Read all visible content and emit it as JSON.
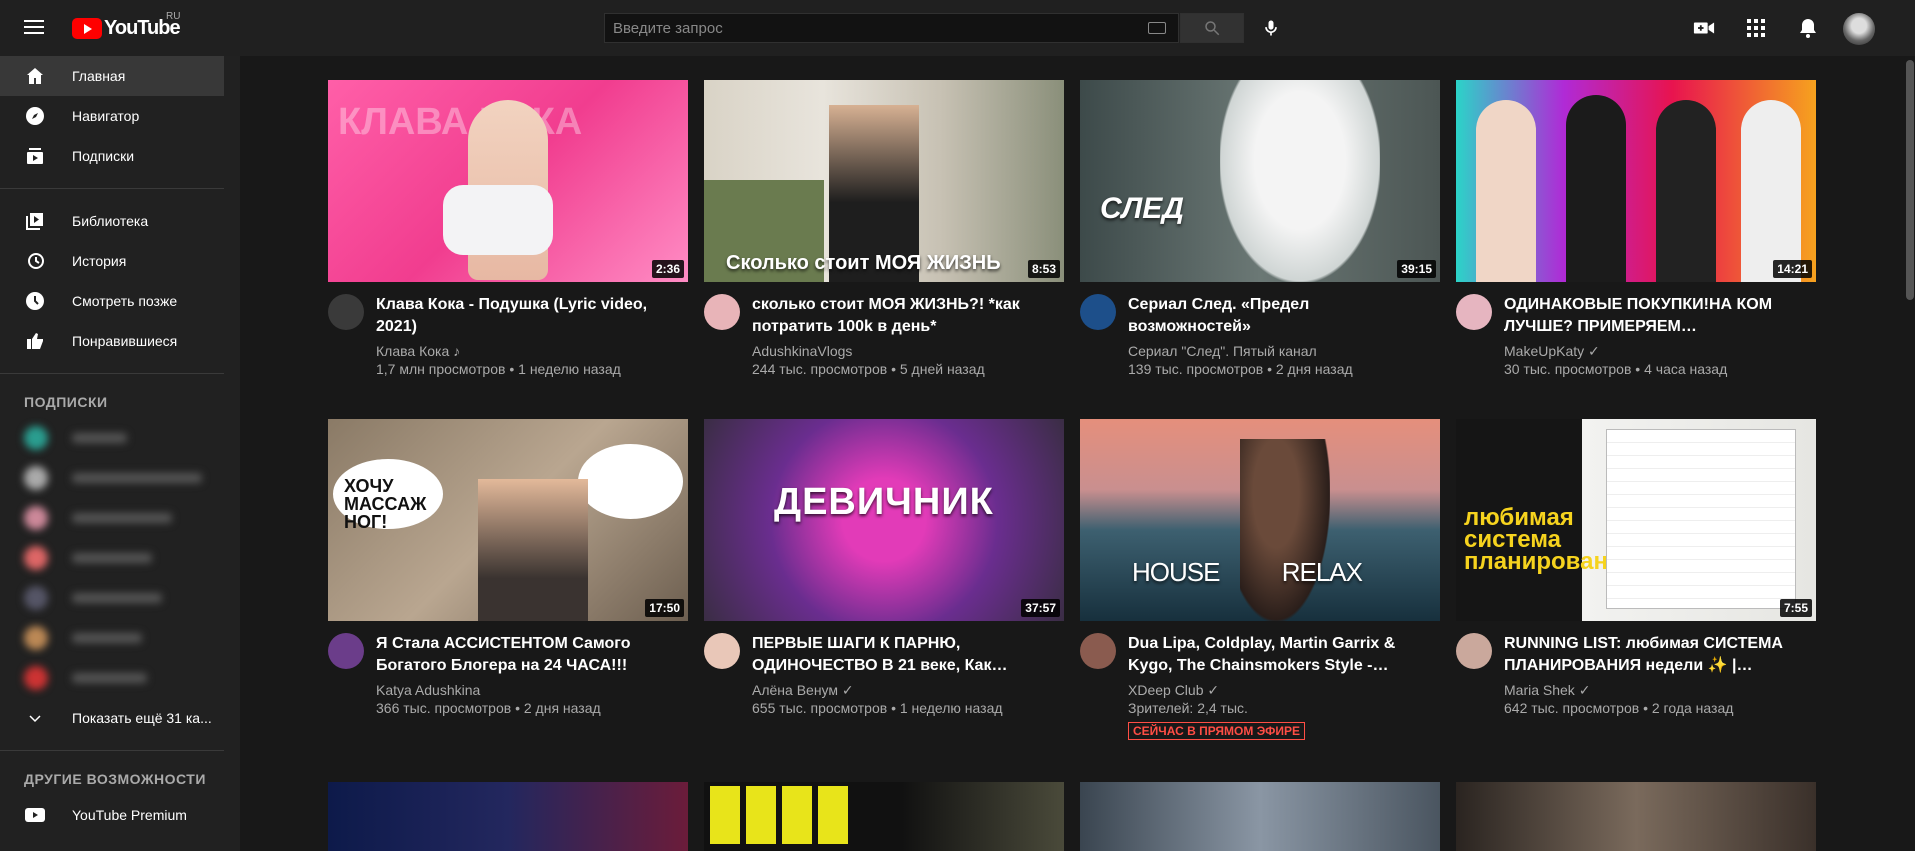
{
  "header": {
    "logo_text": "YouTube",
    "region": "RU",
    "search_placeholder": "Введите запрос"
  },
  "sidebar": {
    "main": [
      {
        "label": "Главная",
        "icon": "home-icon"
      },
      {
        "label": "Навигатор",
        "icon": "compass-icon"
      },
      {
        "label": "Подписки",
        "icon": "subscriptions-icon"
      }
    ],
    "library": [
      {
        "label": "Библиотека",
        "icon": "library-icon"
      },
      {
        "label": "История",
        "icon": "history-icon"
      },
      {
        "label": "Смотреть позже",
        "icon": "clock-icon"
      },
      {
        "label": "Понравившиеся",
        "icon": "thumbs-up-icon"
      }
    ],
    "subs_heading": "ПОДПИСКИ",
    "show_more": "Показать ещё 31 ка...",
    "other_heading": "ДРУГИЕ ВОЗМОЖНОСТИ",
    "premium": "YouTube Premium"
  },
  "videos": [
    {
      "title": "Клава Кока - Подушка (Lyric video, 2021)",
      "channel": "Клава Кока ♪",
      "views": "1,7 млн просмотров",
      "age": "1 неделю назад",
      "duration": "2:36",
      "overlay": "КЛАВА КОКА"
    },
    {
      "title": "сколько стоит МОЯ ЖИЗНЬ?! *как потратить 100k в день*",
      "channel": "AdushkinaVlogs",
      "views": "244 тыс. просмотров",
      "age": "5 дней назад",
      "duration": "8:53",
      "overlay": "Сколько стоит МОЯ ЖИЗНЬ"
    },
    {
      "title": "Сериал След. «Предел возможностей»",
      "channel": "Сериал \"След\". Пятый канал",
      "views": "139 тыс. просмотров",
      "age": "2 дня назад",
      "duration": "39:15",
      "overlay": "СЛЕД"
    },
    {
      "title": "ОДИНАКОВЫЕ ПОКУПКИ!НА КОМ ЛУЧШЕ? ПРИМЕРЯЕМ…",
      "channel": "MakeUpKaty ✓",
      "views": "30 тыс. просмотров",
      "age": "4 часа назад",
      "duration": "14:21",
      "overlay": ""
    },
    {
      "title": "Я Стала АССИСТЕНТОМ Самого Богатого Блогера на 24 ЧАСА!!!",
      "channel": "Katya Adushkina",
      "views": "366 тыс. просмотров",
      "age": "2 дня назад",
      "duration": "17:50",
      "overlay": "ХОЧУ МАССАЖ НОГ!"
    },
    {
      "title": "ПЕРВЫЕ ШАГИ К ПАРНЮ, ОДИНОЧЕСТВО В 21 веке, Как…",
      "channel": "Алёна Венум ✓",
      "views": "655 тыс. просмотров",
      "age": "1 неделю назад",
      "duration": "37:57",
      "overlay": "ДЕВИЧНИК"
    },
    {
      "title": "Dua Lipa, Coldplay, Martin Garrix & Kygo, The Chainsmokers Style -…",
      "channel": "XDeep Club ✓",
      "views": "Зрителей: 2,4 тыс.",
      "age": "",
      "duration": "",
      "live": "СЕЙЧАС В ПРЯМОМ ЭФИРЕ",
      "overlay": "HOUSE          RELAX"
    },
    {
      "title": "RUNNING LIST: любимая СИСТЕМА ПЛАНИРОВАНИЯ недели ✨ |…",
      "channel": "Maria Shek ✓",
      "views": "642 тыс. просмотров",
      "age": "2 года назад",
      "duration": "7:55",
      "overlay": "любимая система планирования"
    }
  ],
  "colors": {
    "accent": "#ff0000",
    "bg": "#181818",
    "header": "#202020",
    "sidebar": "#212121"
  }
}
